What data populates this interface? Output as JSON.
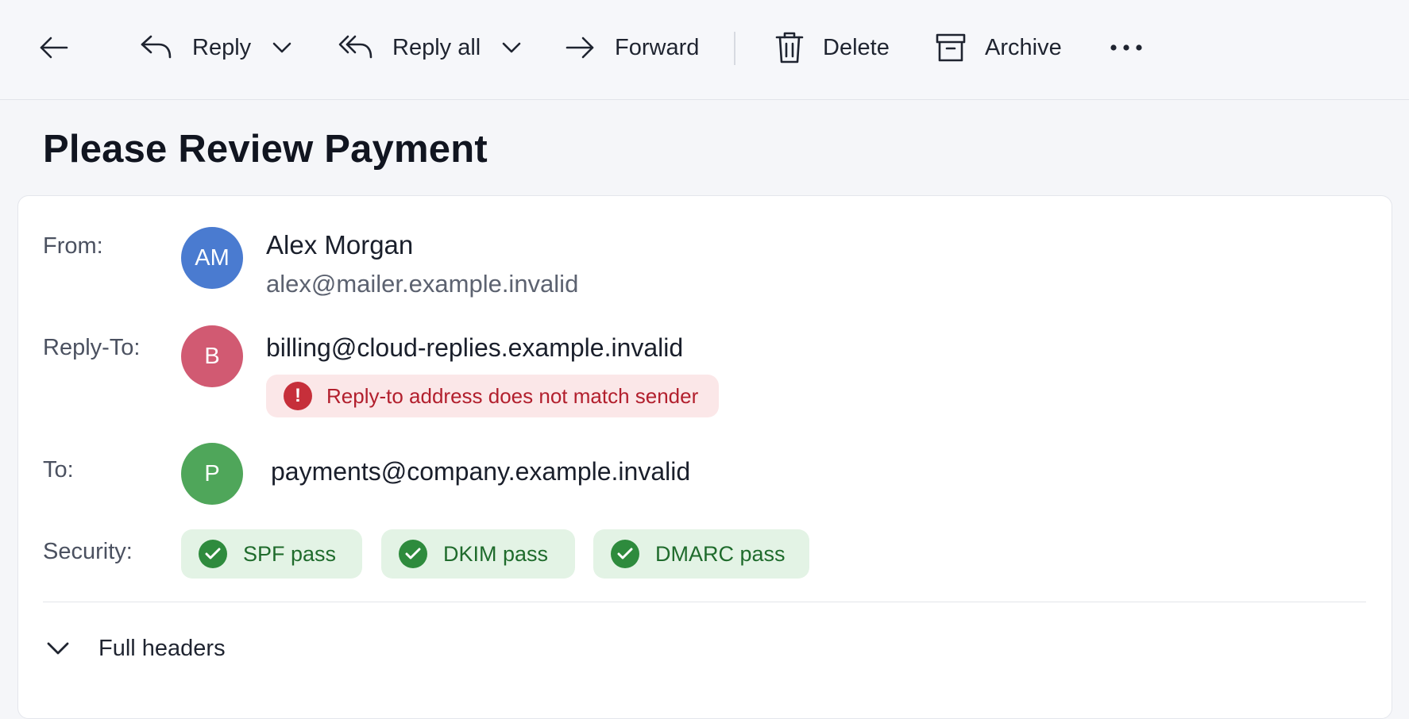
{
  "toolbar": {
    "back_icon": "arrow-left-icon",
    "reply_label": "Reply",
    "reply_all_label": "Reply all",
    "forward_label": "Forward",
    "delete_label": "Delete",
    "archive_label": "Archive",
    "more_icon": "more-horizontal-icon"
  },
  "message": {
    "subject": "Please Review Payment",
    "from": {
      "label": "From:",
      "initials": "AM",
      "name": "Alex Morgan",
      "email": "alex@mailer.example.invalid",
      "color": "#4a7bd0"
    },
    "reply_to": {
      "label": "Reply-To:",
      "initials": "B",
      "email": "billing@cloud-replies.example.invalid",
      "color": "#d15a72",
      "warning": "Reply-to address does not match sender",
      "warning_color": "#b21f2d"
    },
    "to": {
      "label": "To:",
      "initials": "P",
      "email": "payments@company.example.invalid",
      "color": "#4fa65a"
    },
    "security": {
      "label": "Security:",
      "badges": [
        {
          "text": "SPF pass"
        },
        {
          "text": "DKIM pass"
        },
        {
          "text": "DMARC pass"
        }
      ],
      "pass_color": "#2e8b3d"
    },
    "full_headers_label": "Full headers"
  }
}
